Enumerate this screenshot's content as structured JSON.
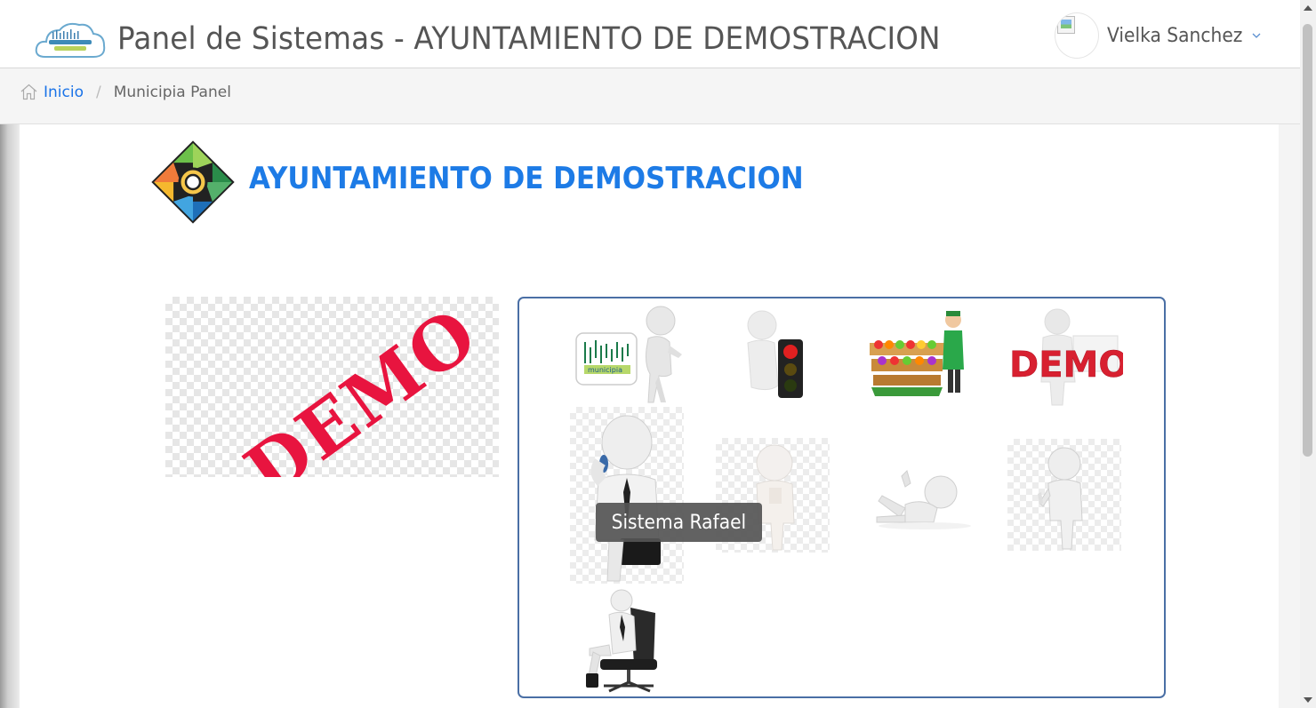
{
  "header": {
    "logo_icon": "municipia-cloud-logo",
    "title": "Panel de Sistemas - AYUNTAMIENTO DE DEMOSTRACION",
    "user": {
      "name": "Vielka Sanchez",
      "avatar_icon": "broken-image-icon",
      "menu_icon": "chevron-down-icon"
    }
  },
  "breadcrumb": {
    "home_icon": "home-icon",
    "home_label": "Inicio",
    "separator": "/",
    "current": "Municipia Panel"
  },
  "organization": {
    "name": "AYUNTAMIENTO DE DEMOSTRACION",
    "logo_icon": "organization-logo",
    "banner_text": "DEMO"
  },
  "systems": {
    "tiles": [
      {
        "id": "municipia",
        "label": "municipia"
      },
      {
        "id": "semaforo",
        "icon": "traffic-light-icon"
      },
      {
        "id": "mercado",
        "icon": "market-stall-icon"
      },
      {
        "id": "demo",
        "label": "DEMO"
      },
      {
        "id": "rafael",
        "icon": "businessman-phone-icon"
      },
      {
        "id": "figure-pose",
        "icon": "figure-icon"
      },
      {
        "id": "figure-lying",
        "icon": "figure-lying-icon"
      },
      {
        "id": "figure-thumbs-up",
        "icon": "thumbs-up-icon"
      },
      {
        "id": "figure-chair",
        "icon": "figure-chair-icon"
      }
    ],
    "tooltip": "Sistema Rafael"
  },
  "colors": {
    "accent": "#1d7be6",
    "panel_border": "#4a6fa5",
    "demo_red": "#e8143f"
  }
}
